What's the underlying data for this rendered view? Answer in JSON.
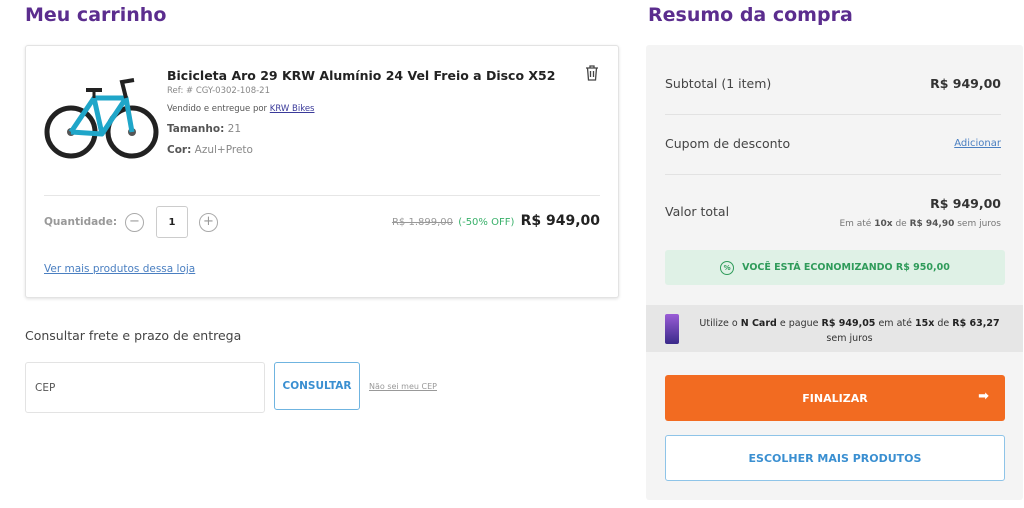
{
  "cart": {
    "title": "Meu carrinho",
    "product": {
      "name": "Bicicleta Aro 29 KRW Alumínio 24 Vel Freio a Disco X52",
      "ref": "Ref: # CGY-0302-108-21",
      "seller_prefix": "Vendido e entregue por",
      "seller": "KRW Bikes",
      "size_label": "Tamanho:",
      "size": "21",
      "color_label": "Cor:",
      "color": "Azul+Preto",
      "qty_label": "Quantidade:",
      "qty": "1",
      "minus": "−",
      "plus": "+",
      "old_price": "R$ 1.899,00",
      "discount": "(-50% OFF)",
      "price": "R$ 949,00",
      "more_link": "Ver mais produtos dessa loja"
    }
  },
  "shipping": {
    "title": "Consultar frete e prazo de entrega",
    "cep_placeholder": "CEP",
    "consult_label": "CONSULTAR",
    "no_cep": "Não sei meu CEP"
  },
  "summary": {
    "title": "Resumo da compra",
    "subtotal_label": "Subtotal (1 item)",
    "subtotal_value": "R$ 949,00",
    "coupon_label": "Cupom de desconto",
    "coupon_link": "Adicionar",
    "total_label": "Valor total",
    "total_value": "R$ 949,00",
    "install_pre": "Em até",
    "install_count": "10x",
    "install_mid": "de",
    "install_value": "R$ 94,90",
    "install_post": "sem juros",
    "economy_icon": "%",
    "economy_text": "VOCÊ ESTÁ ECONOMIZANDO R$ 950,00",
    "ncard_pre": "Utilize o",
    "ncard_name": "N Card",
    "ncard_mid": "e pague",
    "ncard_value": "R$ 949,05",
    "ncard_mid2": "em até",
    "ncard_count": "15x",
    "ncard_mid3": "de",
    "ncard_install": "R$ 63,27",
    "ncard_post": "sem juros",
    "finalize_label": "FINALIZAR",
    "finalize_arrow": "➡",
    "more_products_label": "ESCOLHER MAIS PRODUTOS"
  },
  "colors": {
    "title_purple": "#5b2d8e",
    "finalize_orange": "#f26b21",
    "economy_green": "#2f9b5a",
    "link_blue": "#4a7fc1"
  }
}
